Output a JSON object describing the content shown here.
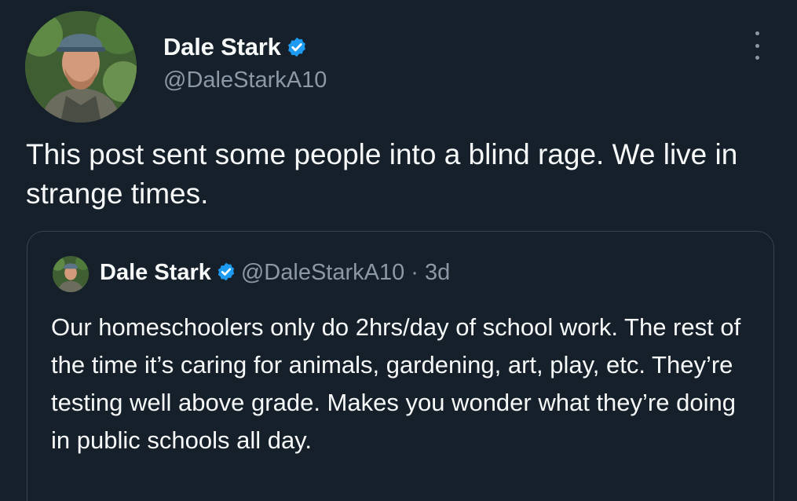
{
  "tweet": {
    "author": {
      "name": "Dale Stark",
      "handle": "@DaleStarkA10"
    },
    "text": "This post sent some people into a blind rage. We live in strange times.",
    "quoted": {
      "author": {
        "name": "Dale Stark",
        "handle": "@DaleStarkA10",
        "separator": "·",
        "time": "3d"
      },
      "text": "Our homeschoolers only do 2hrs/day of school work. The rest of the time it’s caring for animals, gardening, art, play, etc. They’re testing well above grade. Makes you wonder what they’re doing in public schools all day."
    }
  },
  "icons": {
    "verified": "verified-badge-icon",
    "more": "more-options-icon"
  },
  "colors": {
    "background": "#15202b",
    "verified": "#1d9bf0",
    "secondary_text": "#8b98a5",
    "border": "#38444d"
  }
}
